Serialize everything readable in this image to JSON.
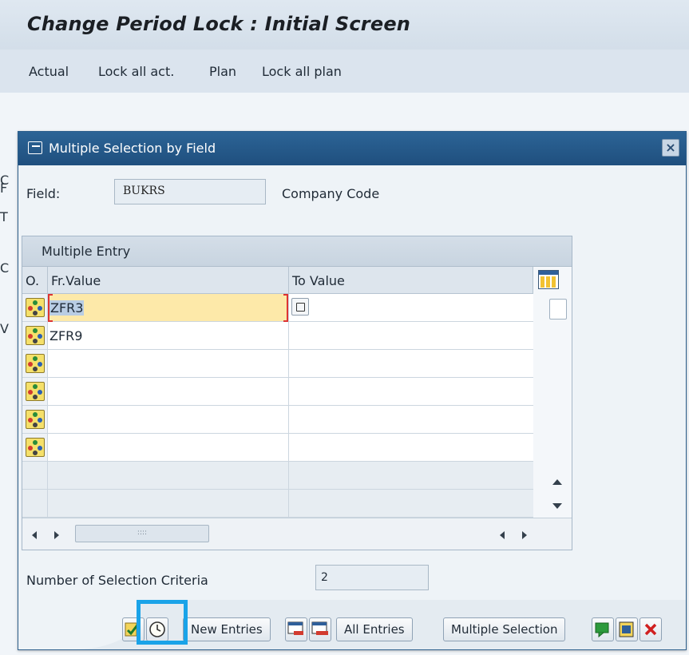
{
  "window": {
    "title": "Change Period Lock : Initial Screen",
    "menu": [
      "Actual",
      "Lock all act.",
      "Plan",
      "Lock all plan"
    ]
  },
  "background_fragments": [
    "C",
    "F",
    "T",
    "C",
    "V"
  ],
  "dialog": {
    "title": "Multiple Selection by Field",
    "close": "×",
    "field": {
      "label": "Field:",
      "value": "BUKRS",
      "description": "Company Code"
    },
    "panel_title": "Multiple Entry",
    "columns": [
      "O.",
      "Fr.Value",
      "To Value"
    ],
    "rows": [
      {
        "from": "ZFR3",
        "to": ""
      },
      {
        "from": "ZFR9",
        "to": ""
      },
      {
        "from": "",
        "to": ""
      },
      {
        "from": "",
        "to": ""
      },
      {
        "from": "",
        "to": ""
      },
      {
        "from": "",
        "to": ""
      }
    ],
    "scroll_grip": "::::",
    "count": {
      "label": "Number of Selection Criteria",
      "value": "2"
    },
    "buttons": {
      "new_entries": "New Entries",
      "all_entries": "All Entries",
      "multiple_selection": "Multiple Selection"
    }
  },
  "colors": {
    "highlight": "#1aa3e8",
    "title_bar": "#1f4f7e",
    "active_cell": "#fde9a9"
  }
}
